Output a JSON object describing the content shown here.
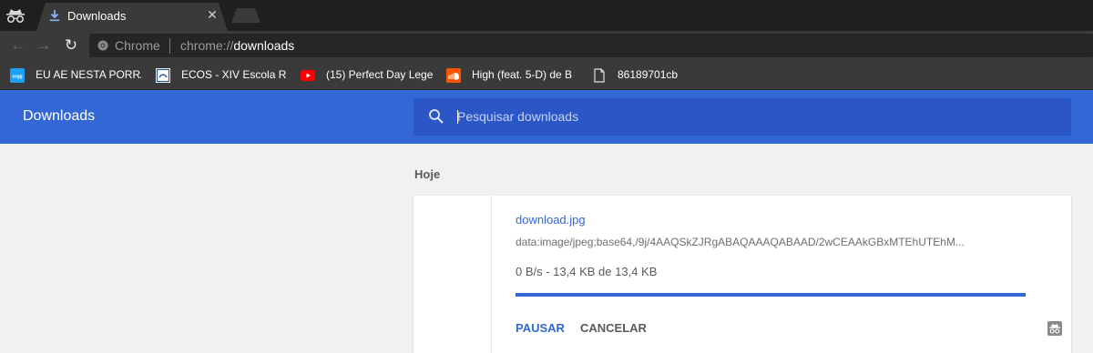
{
  "tab": {
    "title": "Downloads",
    "close": "✕"
  },
  "toolbar": {
    "back": "←",
    "forward": "→",
    "reload": "↻",
    "omnibox_scheme_label": "Chrome",
    "url_prefix": "chrome://",
    "url_host": "downloads"
  },
  "bookmarks": [
    {
      "label": "EU AE NESTA PORRA",
      "icon": "orgg-icon",
      "color": "#1da1f2"
    },
    {
      "label": "ECOS - XIV Escola Re",
      "icon": "ecos-icon",
      "color": "#ffffff"
    },
    {
      "label": "(15) Perfect Day Lege",
      "icon": "youtube-icon",
      "color": "#ff0000"
    },
    {
      "label": "High (feat. 5-D) de B",
      "icon": "soundcloud-icon",
      "color": "#ff5500"
    },
    {
      "label": "86189701cb",
      "icon": "page-icon",
      "color": "#e0e0e0"
    }
  ],
  "header": {
    "title": "Downloads",
    "search_placeholder": "Pesquisar downloads",
    "accent": "#3367d6"
  },
  "section": {
    "label": "Hoje"
  },
  "download": {
    "file_name": "download.jpg",
    "url": "data:image/jpeg;base64,/9j/4AAQSkZJRgABAQAAAQABAAD/2wCEAAkGBxMTEhUTEhM...",
    "status": "0 B/s - 13,4 KB de 13,4 KB",
    "progress": 1.0,
    "pause_label": "PAUSAR",
    "cancel_label": "CANCELAR"
  }
}
